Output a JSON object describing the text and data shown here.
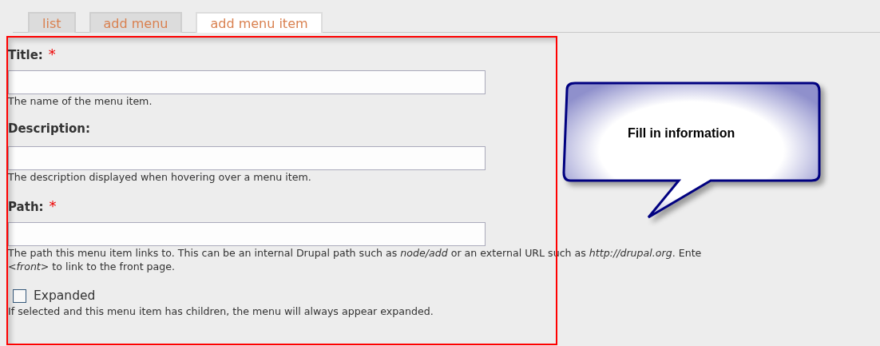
{
  "tabs": [
    {
      "label": "list",
      "selected": false
    },
    {
      "label": "add menu",
      "selected": false
    },
    {
      "label": "add menu item",
      "selected": true
    }
  ],
  "fields": [
    {
      "kind": "text",
      "label": "Title:",
      "required_mark": "*",
      "description": "The name of the menu item."
    },
    {
      "kind": "text",
      "label": "Description:",
      "description": "The description displayed when hovering over a menu item."
    },
    {
      "kind": "text",
      "label": "Path:",
      "required_mark": "*",
      "description": "The path this menu item links to. This can be an internal Drupal path such as *node/add* or an external URL such as *http://drupal.org*. Ente",
      "description_more": "<*front*> to link to the front page."
    },
    {
      "kind": "checkbox",
      "label": "Expanded",
      "checked": false,
      "description": "If selected and this menu item has children, the menu will always appear expanded."
    }
  ],
  "callout": {
    "text": "Fill in information"
  }
}
